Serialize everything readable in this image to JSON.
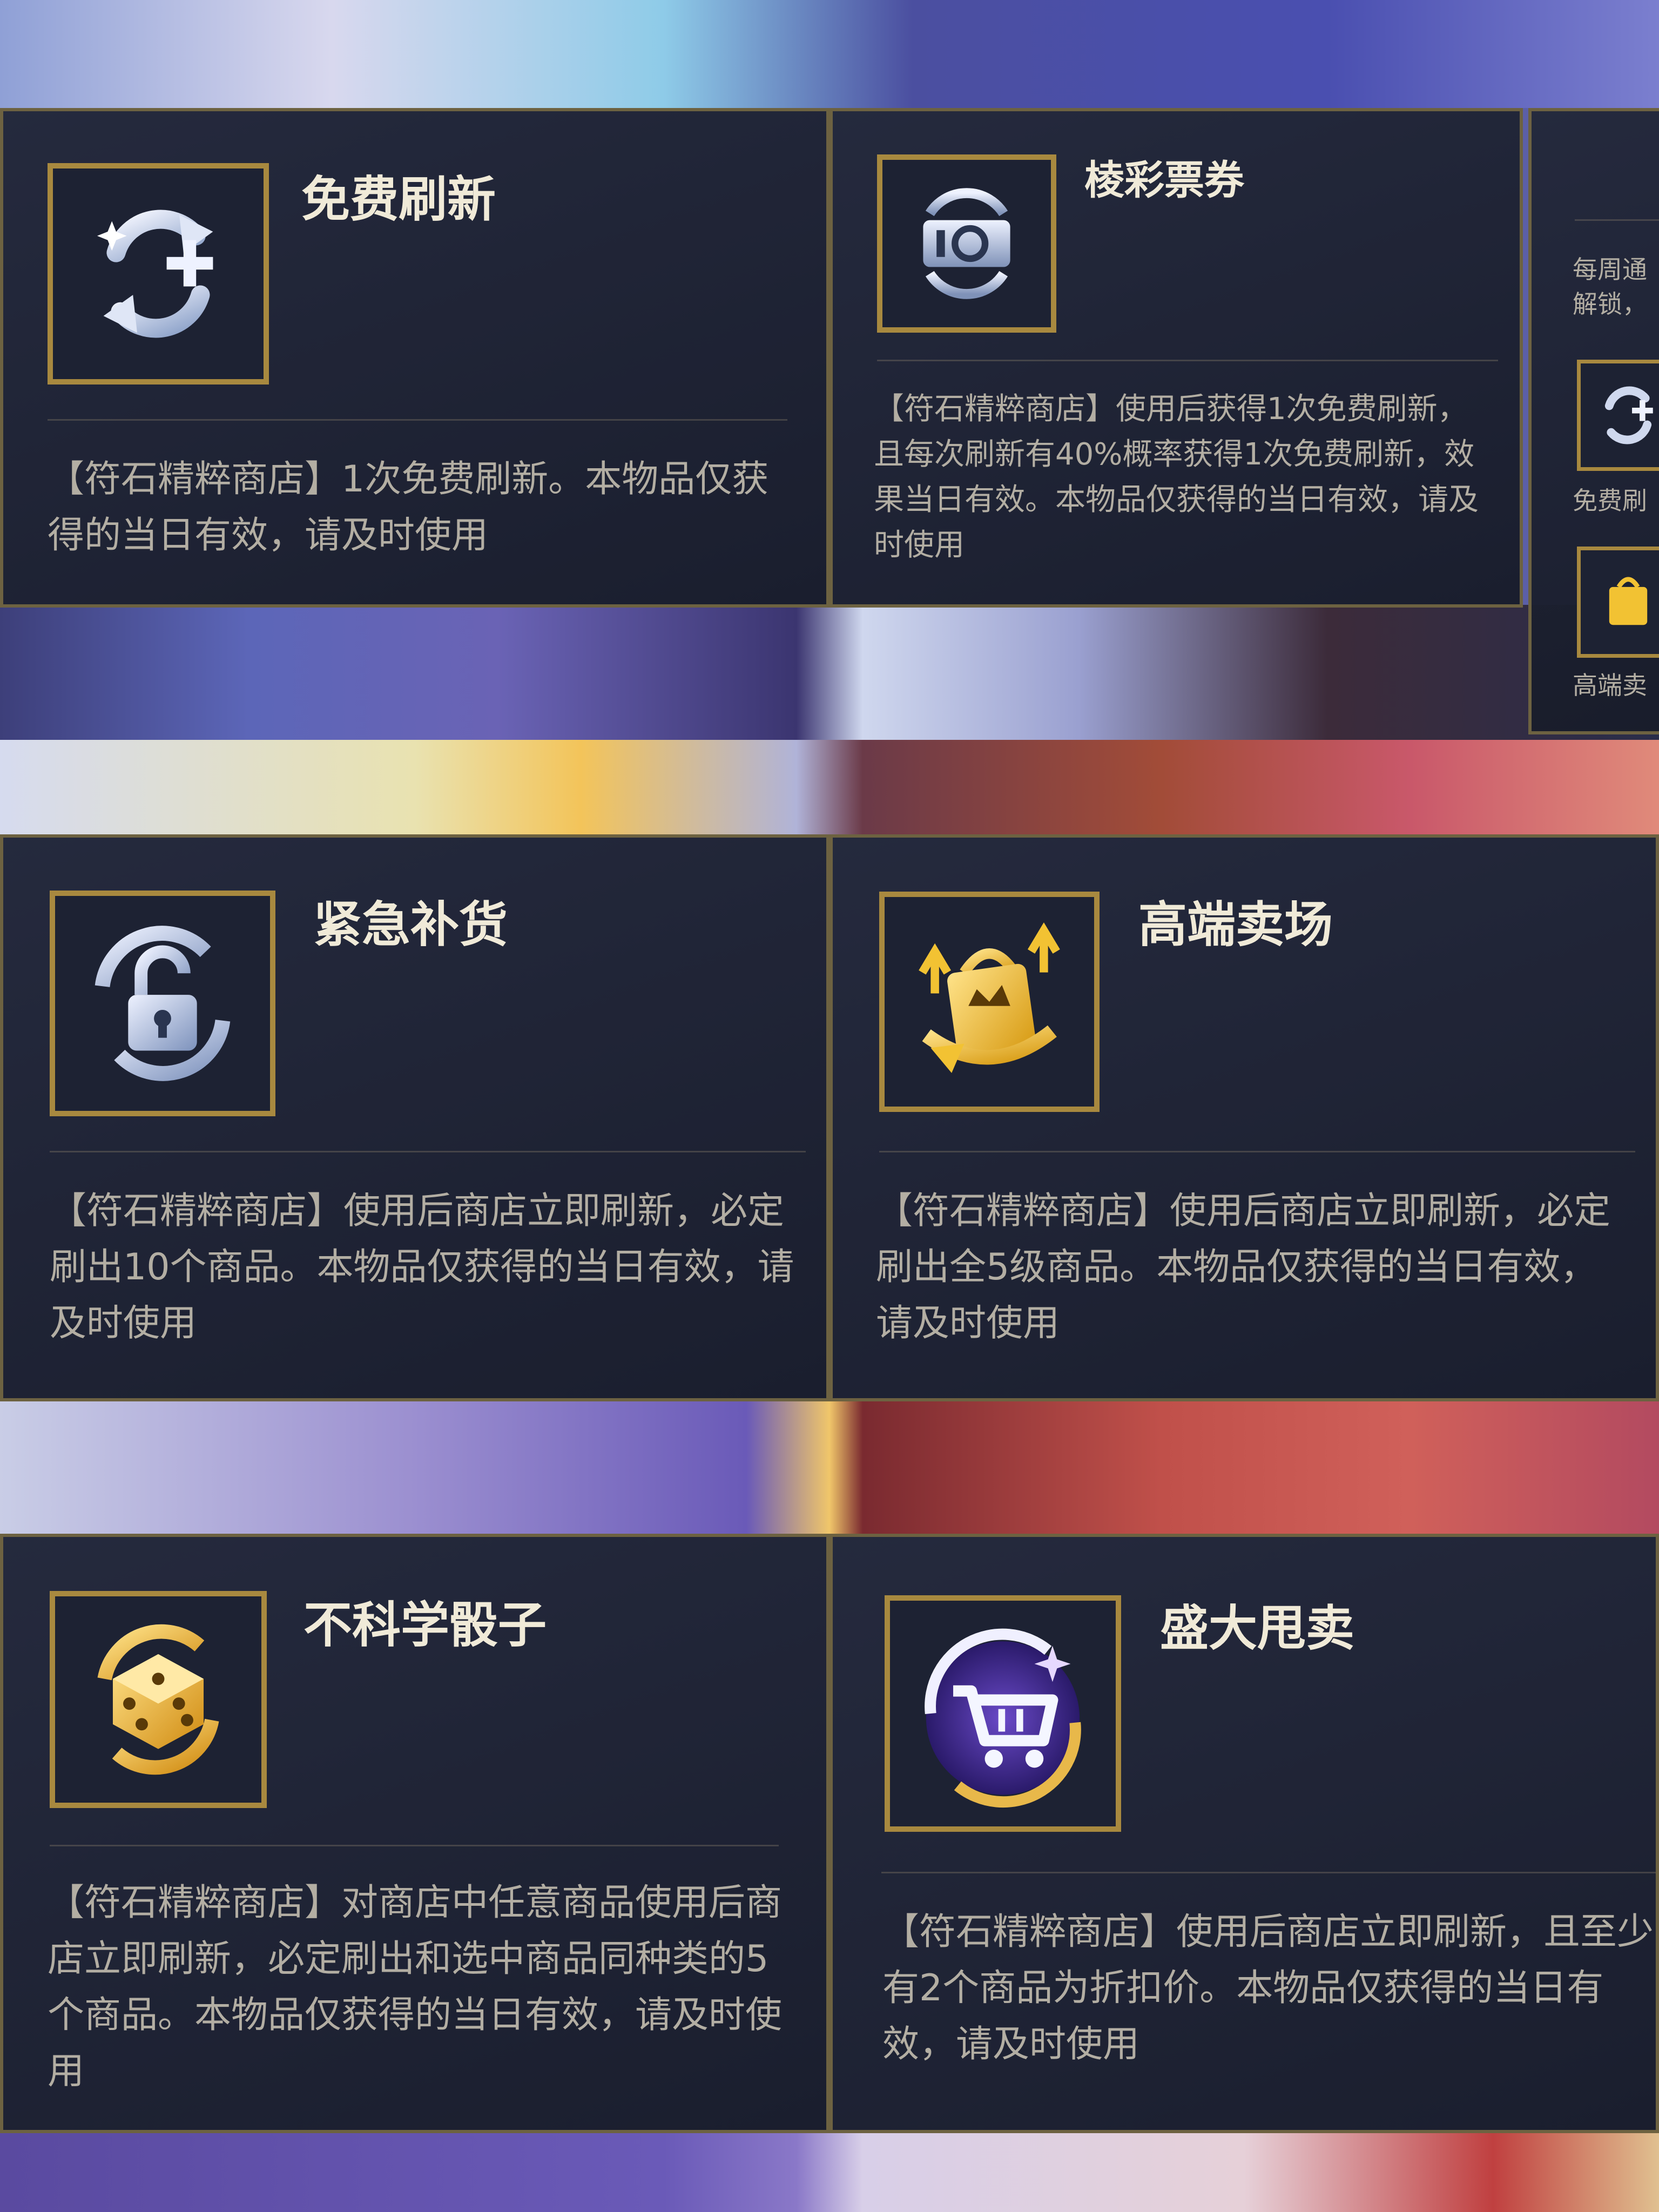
{
  "cards": [
    {
      "title": "免费刷新",
      "icon": "refresh-plus-icon",
      "description": "【符石精粹商店】1次免费刷新。本物品仅获得的当日有效，请及时使用"
    },
    {
      "title": "棱彩票券",
      "icon": "ticket-refresh-icon",
      "description": "【符石精粹商店】使用后获得1次免费刷新，且每次刷新有40%概率获得1次免费刷新，效果当日有效。本物品仅获得的当日有效，请及时使用"
    },
    {
      "title": "紧急补货",
      "icon": "unlock-refresh-icon",
      "description": "【符石精粹商店】使用后商店立即刷新，必定刷出10个商品。本物品仅获得的当日有效，请及时使用"
    },
    {
      "title": "高端卖场",
      "icon": "crown-bag-icon",
      "description": "【符石精粹商店】使用后商店立即刷新，必定刷出全5级商品。本物品仅获得的当日有效，请及时使用"
    },
    {
      "title": "不科学骰子",
      "icon": "dice-icon",
      "description": "【符石精粹商店】对商店中任意商品使用后商店立即刷新，必定刷出和选中商品同种类的5个商品。本物品仅获得的当日有效，请及时使用"
    },
    {
      "title": "盛大甩卖",
      "icon": "cart-sale-icon",
      "description": "【符石精粹商店】使用后商店立即刷新，且至少有2个商品为折扣价。本物品仅获得的当日有效，请及时使用"
    }
  ],
  "side_panel": {
    "text_line1": "每周通",
    "text_line2": "解锁，",
    "item1_label": "免费刷",
    "item2_label": "高端卖"
  },
  "colors": {
    "gold_frame": "#a8893f",
    "panel_bg": "#1f2435",
    "title": "#f0ead8",
    "desc": "#b3aea3"
  }
}
